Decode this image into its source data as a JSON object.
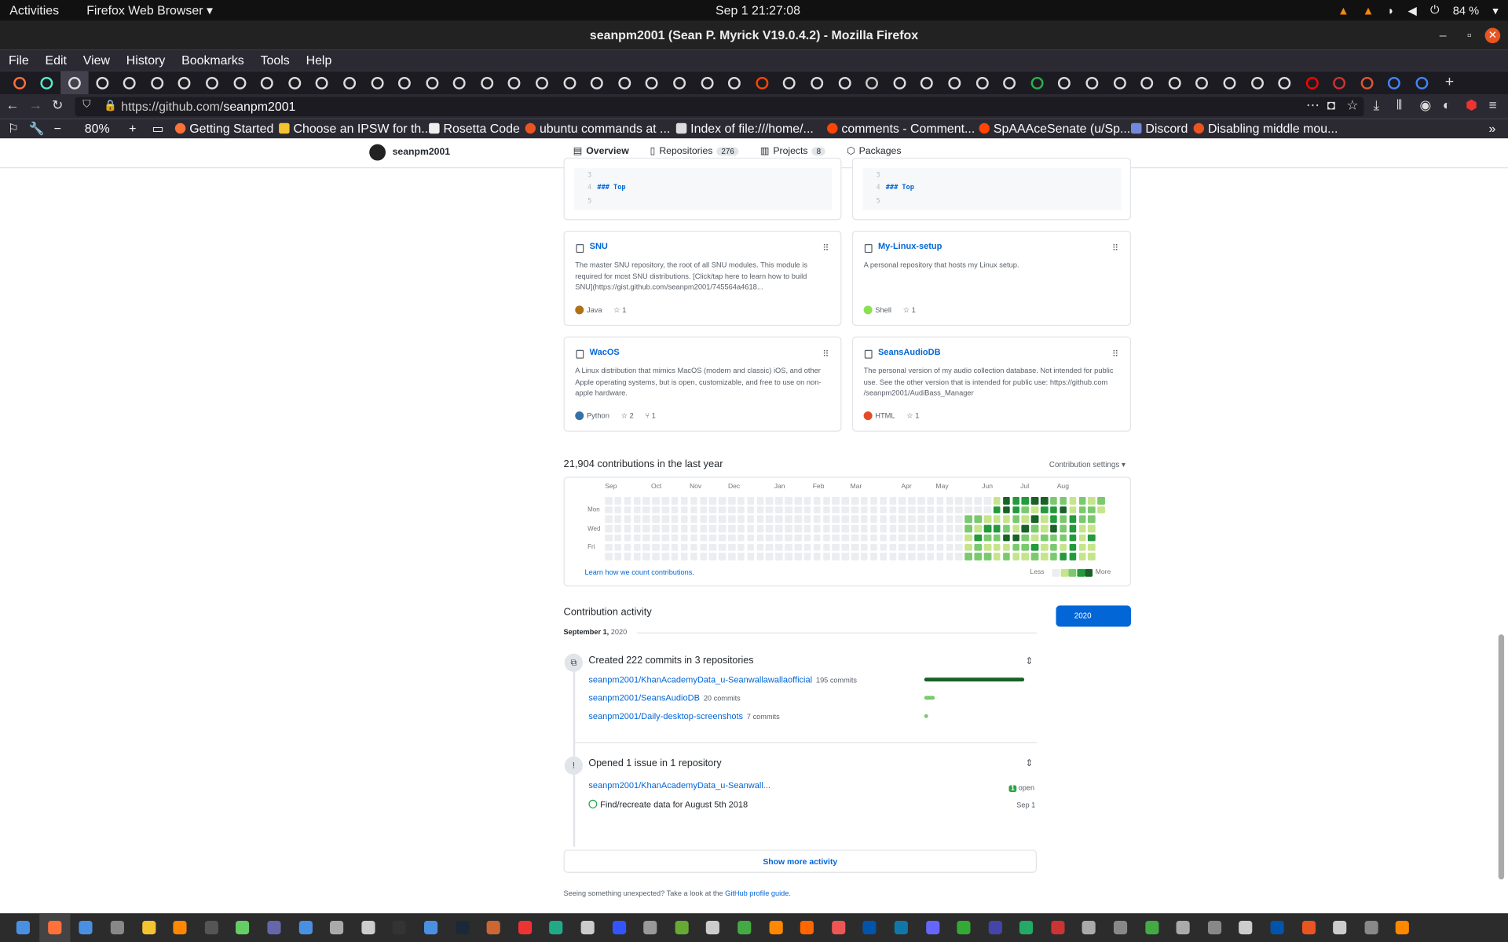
{
  "system": {
    "activities": "Activities",
    "app_menu": "Firefox Web Browser ▾",
    "clock": "Sep 1  21:27:08",
    "battery": "84 %"
  },
  "window": {
    "title": "seanpm2001 (Sean P. Myrick V19.0.4.2) - Mozilla Firefox"
  },
  "menu": [
    "File",
    "Edit",
    "View",
    "History",
    "Bookmarks",
    "Tools",
    "Help"
  ],
  "address": {
    "prefix": "https://github.com/",
    "host": "seanpm2001"
  },
  "zoom": "80%",
  "bookmarks": [
    {
      "label": "Getting Started",
      "color": "#ff7139"
    },
    {
      "label": "Choose an IPSW for th...",
      "color": "#f4c430"
    },
    {
      "label": "Rosetta Code",
      "color": "#eee"
    },
    {
      "label": "ubuntu commands at ...",
      "color": "#e95420"
    },
    {
      "label": "Index of file:///home/...",
      "color": "#ddd"
    },
    {
      "label": "comments - Comment...",
      "color": "#ff4500"
    },
    {
      "label": "SpAAAceSenate (u/Sp...",
      "color": "#ff4500"
    },
    {
      "label": "Discord",
      "color": "#7289da"
    },
    {
      "label": "Disabling middle mou...",
      "color": "#e95420"
    }
  ],
  "profile": {
    "username": "seanpm2001"
  },
  "tabs": [
    {
      "label": "Overview",
      "count": ""
    },
    {
      "label": "Repositories",
      "count": "276"
    },
    {
      "label": "Projects",
      "count": "8"
    },
    {
      "label": "Packages",
      "count": ""
    }
  ],
  "code_snippet": {
    "lines": [
      "3",
      "4",
      "5"
    ],
    "heading": "### Top"
  },
  "pinned": [
    {
      "name": "SNU",
      "desc": "The master SNU repository, the root of all SNU modules. This module is required for most SNU distributions. [Click/tap here to learn how to build SNU](https://gist.github.com/seanpm2001/745564a4618...",
      "lang": "Java",
      "lang_color": "#b07219",
      "stars": "1",
      "forks": ""
    },
    {
      "name": "My-Linux-setup",
      "desc": "A personal repository that hosts my Linux setup.",
      "lang": "Shell",
      "lang_color": "#89e051",
      "stars": "1",
      "forks": ""
    },
    {
      "name": "WacOS",
      "desc": "A Linux distribution that mimics MacOS (modern and classic) iOS, and other Apple operating systems, but is open, customizable, and free to use on non-apple hardware.",
      "lang": "Python",
      "lang_color": "#3572A5",
      "stars": "2",
      "forks": "1"
    },
    {
      "name": "SeansAudioDB",
      "desc": "The personal version of my audio collection database. Not intended for public use. See the other version that is intended for public use: https://github.com /seanpm2001/AudiBass_Manager",
      "lang": "HTML",
      "lang_color": "#e34c26",
      "stars": "1",
      "forks": ""
    }
  ],
  "contributions": {
    "heading": "21,904 contributions in the last year",
    "settings": "Contribution settings ▾",
    "months": [
      "Sep",
      "Oct",
      "Nov",
      "Dec",
      "Jan",
      "Feb",
      "Mar",
      "Apr",
      "May",
      "Jun",
      "Jul",
      "Aug"
    ],
    "days": [
      "Mon",
      "Wed",
      "Fri"
    ],
    "learn": "Learn how we count contributions.",
    "less": "Less",
    "more": "More",
    "colors": [
      "#ebedf0",
      "#c6e48b",
      "#7bc96f",
      "#239a3b",
      "#196127"
    ]
  },
  "activity": {
    "heading": "Contribution activity",
    "year": "2020",
    "date_bold": "September 1,",
    "date_year": "2020",
    "commits_title": "Created 222 commits in 3 repositories",
    "commit_repos": [
      {
        "name": "seanpm2001/KhanAcademyData_u-Seanwallawallaofficial",
        "count": "195 commits",
        "share": 0.88
      },
      {
        "name": "seanpm2001/SeansAudioDB",
        "count": "20 commits",
        "share": 0.09
      },
      {
        "name": "seanpm2001/Daily-desktop-screenshots",
        "count": "7 commits",
        "share": 0.03
      }
    ],
    "issues_title": "Opened 1 issue in 1 repository",
    "issue_repo": "seanpm2001/KhanAcademyData_u-Seanwall...",
    "issue_badge_count": "1",
    "issue_badge_label": "open",
    "issue_title": "Find/recreate data for August 5th 2018",
    "issue_date": "Sep 1",
    "show_more": "Show more activity",
    "footer_text": "Seeing something unexpected? Take a look at the",
    "footer_link": "GitHub profile guide."
  }
}
